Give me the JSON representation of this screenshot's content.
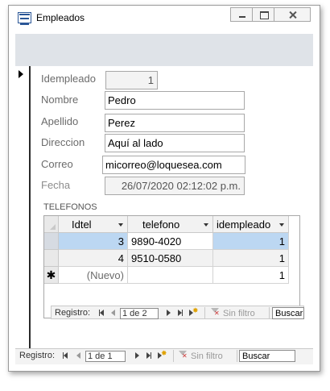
{
  "window": {
    "title": "Empleados",
    "icon": "form-icon"
  },
  "form": {
    "fields": {
      "idempleado": {
        "label": "Idempleado",
        "value": "1"
      },
      "nombre": {
        "label": "Nombre",
        "value": "Pedro"
      },
      "apellido": {
        "label": "Apellido",
        "value": "Perez"
      },
      "direccion": {
        "label": "Direccion",
        "value": "Aquí al lado"
      },
      "correo": {
        "label": "Correo",
        "value": "micorreo@loquesea.com"
      },
      "fecha": {
        "label": "Fecha",
        "value": "26/07/2020 02:12:02 p.m."
      }
    },
    "subform_label": "TELEFONOS"
  },
  "subform": {
    "columns": [
      "Idtel",
      "telefono",
      "idempleado"
    ],
    "rows": [
      {
        "idtel": "3",
        "telefono": "9890-4020",
        "idempleado": "1"
      },
      {
        "idtel": "4",
        "telefono": "9510-0580",
        "idempleado": "1"
      },
      {
        "idtel": "(Nuevo)",
        "telefono": "",
        "idempleado": "1",
        "new_marker": "✱"
      }
    ],
    "nav": {
      "label": "Registro:",
      "position": "1 de 2",
      "filter": "Sin filtro",
      "search": "Buscar"
    }
  },
  "main_nav": {
    "label": "Registro:",
    "position": "1 de 1",
    "filter": "Sin filtro",
    "search": "Buscar"
  }
}
